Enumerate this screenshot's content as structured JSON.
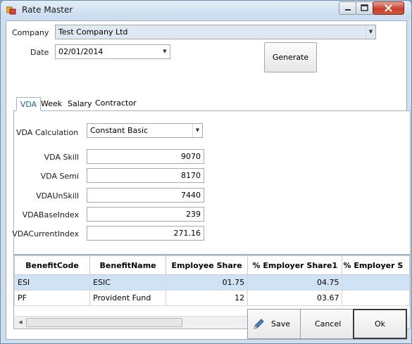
{
  "window": {
    "title": "Rate Master"
  },
  "company": {
    "label": "Company",
    "value": "Test Company Ltd"
  },
  "date": {
    "label": "Date",
    "value": "02/01/2014"
  },
  "generate_label": "Generate",
  "tabs": [
    {
      "label": "VDA",
      "active": true
    },
    {
      "label": "Week"
    },
    {
      "label": "Salary"
    },
    {
      "label": "Contractor"
    }
  ],
  "vda": {
    "calc_label": "VDA Calculation",
    "calc_value": "Constant Basic",
    "fields": [
      {
        "label": "VDA Skill",
        "value": "9070"
      },
      {
        "label": "VDA Semi",
        "value": "8170"
      },
      {
        "label": "VDAUnSkill",
        "value": "7440"
      },
      {
        "label": "VDABaseIndex",
        "value": "239"
      },
      {
        "label": "VDACurrentIndex",
        "value": "271.16"
      }
    ]
  },
  "grid": {
    "columns": [
      "BenefitCode",
      "BenefitName",
      "Employee Share",
      "% Employer Share1",
      "% Employer S"
    ],
    "rows": [
      [
        "ESI",
        "ESIC",
        "01.75",
        "04.75",
        ""
      ],
      [
        "PF",
        "Provident Fund",
        "12",
        "03.67",
        ""
      ]
    ]
  },
  "footer": {
    "save": "Save",
    "cancel": "Cancel",
    "ok": "Ok"
  },
  "colors": {
    "selected_row": "#cfe3f5",
    "active_tab_text": "#1f5f9e"
  }
}
